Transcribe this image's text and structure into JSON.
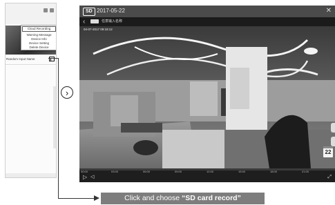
{
  "phone": {
    "menu_items": [
      "Cloud Recording",
      "Warning Message",
      "Device Info",
      "Device Setting",
      "Delete Device"
    ],
    "device_name": "Random Input Name"
  },
  "player": {
    "badge": "SD",
    "date": "2017-05-22",
    "camera_name": "任意输入名称",
    "timestamp": "04-07-2017 09:18:12",
    "calendar_day": "22",
    "timeline_ticks": [
      "00:00",
      "03:00",
      "06:00",
      "09:00",
      "12:00",
      "15:00",
      "18:00",
      "21:00"
    ]
  },
  "callout": {
    "prefix": "Click and choose ",
    "highlight": "“SD card record”"
  }
}
